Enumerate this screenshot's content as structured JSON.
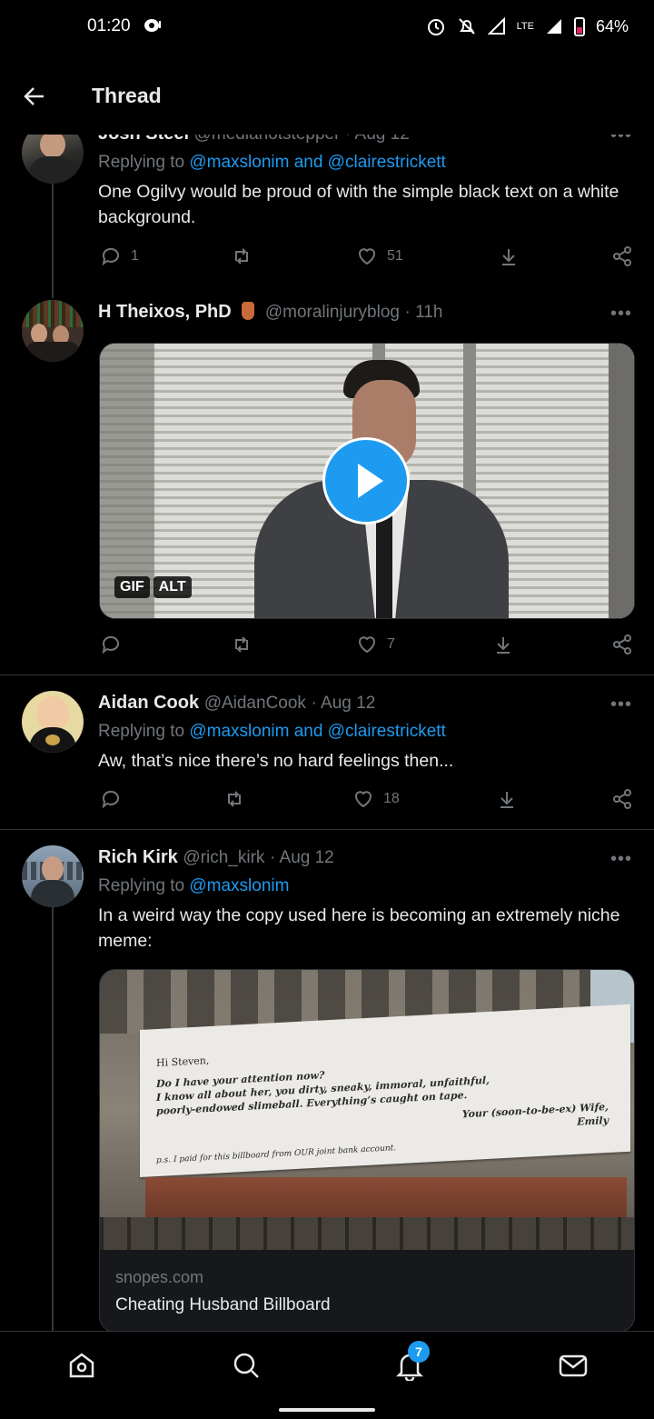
{
  "status_bar": {
    "time": "01:20",
    "lte": "LTE",
    "battery": "64%"
  },
  "header": {
    "title": "Thread"
  },
  "tweets": [
    {
      "name": "Josh Steel",
      "handle": "@medianotstepper",
      "time": "· Aug 12",
      "reply_prefix": "Replying to",
      "reply_to": "@maxslonim and @clairestrickett",
      "text": "One Ogilvy would be proud of with the simple black text on a white background.",
      "replies": "1",
      "likes": "51"
    },
    {
      "name": "H Theixos, PhD",
      "handle": "@moralinjuryblog",
      "time": "· 11h",
      "media_badges": [
        "GIF",
        "ALT"
      ],
      "likes": "7"
    },
    {
      "name": "Aidan Cook",
      "handle": "@AidanCook",
      "time": "· Aug 12",
      "reply_prefix": "Replying to",
      "reply_to": "@maxslonim and @clairestrickett",
      "text": "Aw, that’s nice there’s no hard feelings then...",
      "likes": "18"
    },
    {
      "name": "Rich Kirk",
      "handle": "@rich_kirk",
      "time": "· Aug 12",
      "reply_prefix": "Replying to",
      "reply_to": "@maxslonim",
      "text": "In a weird way the copy used here is becoming an extremely niche meme:",
      "billboard": {
        "l1": "Hi Steven,",
        "l2": "Do I have your attention now?",
        "l3": "I know all about her, you dirty, sneaky, immoral, unfaithful,",
        "l4": "poorly-endowed slimeball. Everything’s caught on tape.",
        "l5": "Your (soon-to-be-ex) Wife,",
        "l6": "Emily",
        "l7": "p.s. I paid for this billboard from OUR joint bank account."
      },
      "link_domain": "snopes.com",
      "link_title": "Cheating Husband Billboard"
    }
  ],
  "nav": {
    "notification_count": "7"
  },
  "colors": {
    "accent": "#1d9bf0",
    "background": "#000000",
    "muted": "#71767b"
  }
}
